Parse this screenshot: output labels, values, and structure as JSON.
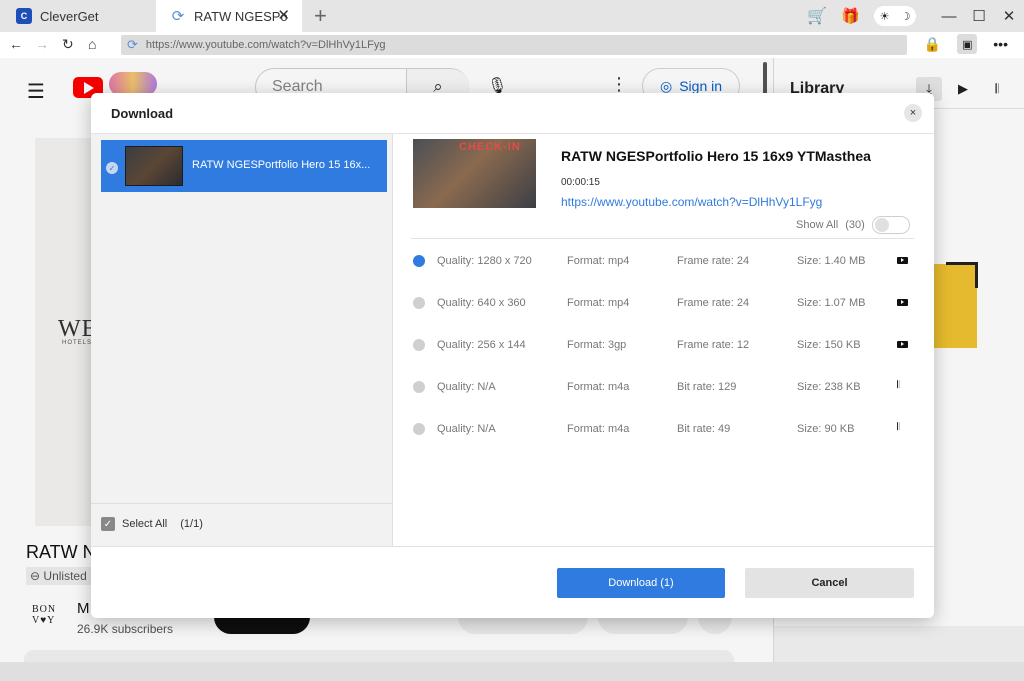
{
  "browser": {
    "tabs": [
      {
        "label": "CleverGet",
        "icon": "cleverget-logo-icon"
      },
      {
        "label": "RATW NGESPo",
        "icon": "refresh-icon"
      }
    ],
    "url": "https://www.youtube.com/watch?v=DlHhVy1LFyg"
  },
  "youtube": {
    "search_placeholder": "Search",
    "signin_label": "Sign in",
    "video_title": "RATW N",
    "unlisted_label": "Unlisted",
    "brand_text": "WE",
    "brand_sub": "HOTELS",
    "channel_logo": "BON\nV♥Y",
    "channel_name": "M",
    "subscribers": "26.9K subscribers"
  },
  "library": {
    "title": "Library"
  },
  "dialog": {
    "title": "Download",
    "close_label": "×",
    "items": [
      {
        "label": "RATW NGESPortfolio Hero 15 16x...",
        "checked": true
      }
    ],
    "select_all_label": "Select All",
    "select_all_count": "(1/1)",
    "video": {
      "thumb_sign": "CHECK-IN",
      "title": "RATW NGESPortfolio Hero 15 16x9 YTMasthea",
      "duration": "00:00:15",
      "url": "https://www.youtube.com/watch?v=DlHhVy1LFyg"
    },
    "show_all_label": "Show All",
    "show_all_count": "(30)",
    "qualities": [
      {
        "quality": "Quality: 1280 x 720",
        "format": "Format: mp4",
        "rate": "Frame rate: 24",
        "size": "Size: 1.40 MB",
        "type": "video",
        "selected": true
      },
      {
        "quality": "Quality: 640 x 360",
        "format": "Format: mp4",
        "rate": "Frame rate: 24",
        "size": "Size: 1.07 MB",
        "type": "video",
        "selected": false
      },
      {
        "quality": "Quality: 256 x 144",
        "format": "Format: 3gp",
        "rate": "Frame rate: 12",
        "size": "Size: 150 KB",
        "type": "video",
        "selected": false
      },
      {
        "quality": "Quality: N/A",
        "format": "Format: m4a",
        "rate": "Bit rate: 129",
        "size": "Size: 238 KB",
        "type": "audio",
        "selected": false
      },
      {
        "quality": "Quality: N/A",
        "format": "Format: m4a",
        "rate": "Bit rate: 49",
        "size": "Size: 90 KB",
        "type": "audio",
        "selected": false
      }
    ],
    "download_label": "Download (1)",
    "cancel_label": "Cancel"
  },
  "colors": {
    "accent": "#2f7be0",
    "selected_item_bg": "#2f7be0",
    "youtube_red": "#ff0000",
    "cart_red": "#e8412a"
  }
}
